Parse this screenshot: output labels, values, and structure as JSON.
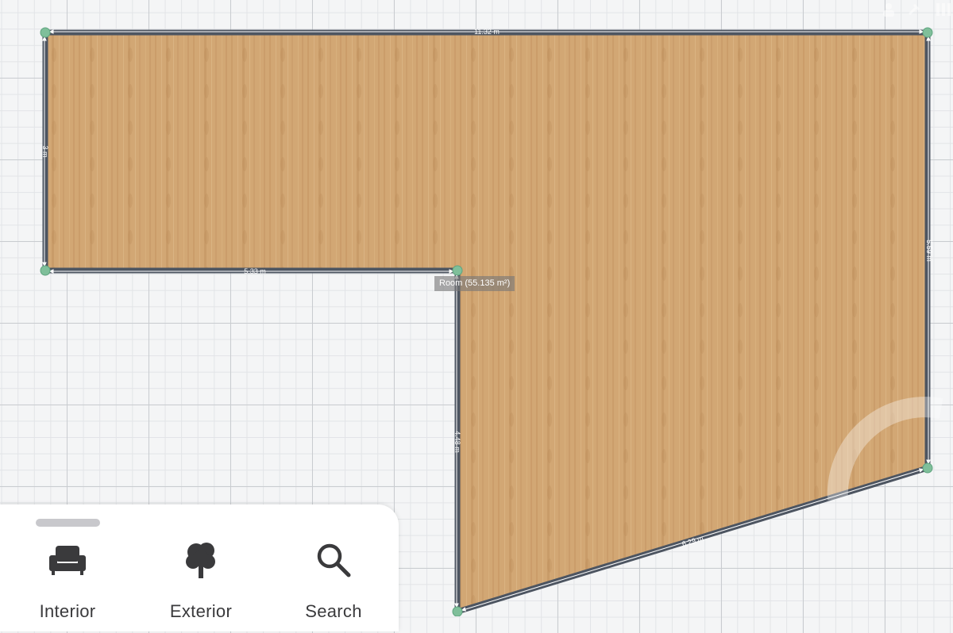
{
  "floorplan": {
    "room_label": "Room (55.135 m²)",
    "dimensions": {
      "top_wall": "11.32 m",
      "left_wall": "3 m",
      "inner_horizontal_wall": "5.33 m",
      "inner_vertical_wall": "4.48 m",
      "right_wall": "5.59 m",
      "diagonal_wall": "6.29 m"
    },
    "colors": {
      "wall": "#4d5561",
      "floor": "#d2a774",
      "node": "#7fbf9a",
      "grid_major": "#c9ccd0",
      "grid_minor": "#e2e4e7"
    }
  },
  "bottom_panel": {
    "items": [
      {
        "label": "Interior",
        "icon": "sofa-icon"
      },
      {
        "label": "Exterior",
        "icon": "tree-icon"
      },
      {
        "label": "Search",
        "icon": "search-icon"
      }
    ]
  }
}
